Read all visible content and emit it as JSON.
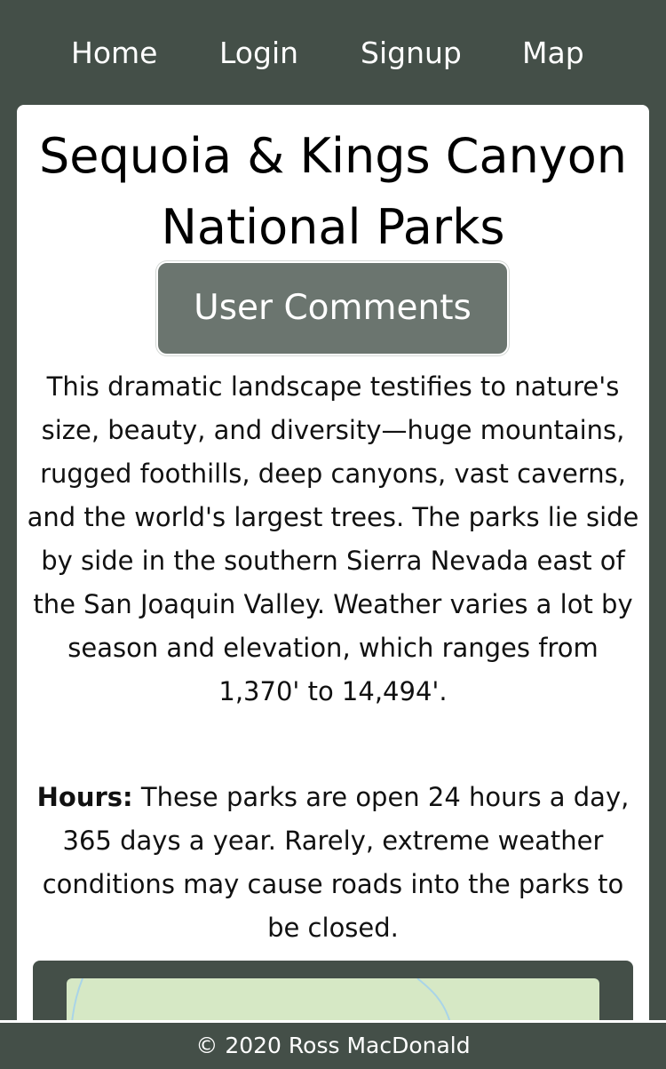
{
  "nav": {
    "items": [
      {
        "label": "Home"
      },
      {
        "label": "Login"
      },
      {
        "label": "Signup"
      },
      {
        "label": "Map"
      }
    ]
  },
  "park": {
    "title": "Sequoia & Kings Canyon National Parks",
    "comments_button": "User Comments",
    "description": "This dramatic landscape testifies to nature's size, beauty, and diversity—huge mountains, rugged foothills, deep canyons, vast caverns, and the world's largest trees. The parks lie side by side in the southern Sierra Nevada east of the San Joaquin Valley. Weather varies a lot by season and elevation, which ranges from 1,370' to 14,494'.",
    "hours_label": "Hours:",
    "hours_text": " These parks are open 24 hours a day, 365 days a year. Rarely, extreme weather conditions may cause roads into the parks to be closed."
  },
  "footer": {
    "text": "© 2020 Ross MacDonald"
  },
  "colors": {
    "background": "#444f48",
    "card": "#ffffff",
    "button": "#6b756f",
    "map_land": "#d6e8c5",
    "map_river": "#a9d4e8"
  }
}
